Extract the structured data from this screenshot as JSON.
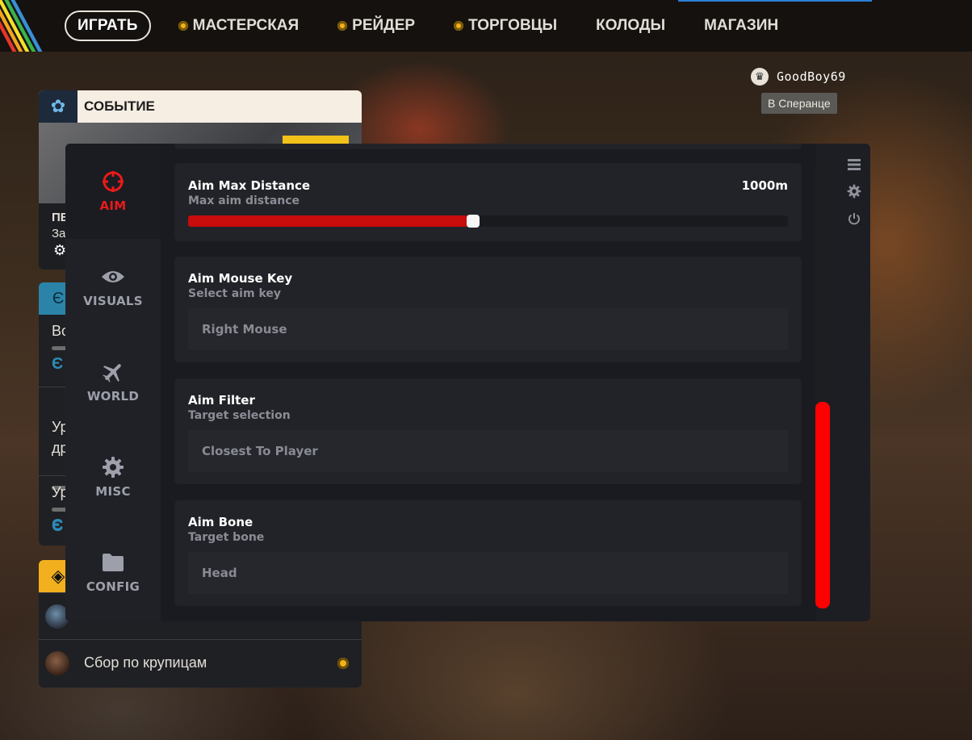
{
  "nav": {
    "play": "ИГРАТЬ",
    "items": [
      {
        "label": "МАСТЕРСКАЯ",
        "coin": true
      },
      {
        "label": "РЕЙДЕР",
        "coin": true
      },
      {
        "label": "ТОРГОВЦЫ",
        "coin": true
      },
      {
        "label": "КОЛОДЫ",
        "coin": false
      },
      {
        "label": "МАГАЗИН",
        "coin": false
      }
    ]
  },
  "player": {
    "name": "GoodBoy69",
    "status": "В Сперанце"
  },
  "event_panel": {
    "title": "СОБЫТИЕ",
    "line1": "ПЕ",
    "line2": "За"
  },
  "tasks_panel": {
    "rows": [
      "Во",
      "Ур\nдр",
      "Ур"
    ],
    "currency_icon": "Є"
  },
  "raid_panel": {
    "rows": [
      {
        "label": ""
      },
      {
        "label": "Сбор по крупицам"
      }
    ]
  },
  "menu": {
    "tabs": [
      {
        "label": "AIM",
        "icon": "crosshair-icon",
        "active": true
      },
      {
        "label": "VISUALS",
        "icon": "eye-icon",
        "active": false
      },
      {
        "label": "WORLD",
        "icon": "plane-icon",
        "active": false
      },
      {
        "label": "MISC",
        "icon": "gear-icon",
        "active": false
      },
      {
        "label": "CONFIG",
        "icon": "folder-icon",
        "active": false
      }
    ],
    "settings": {
      "max_distance": {
        "title": "Aim Max Distance",
        "subtitle": "Max aim distance",
        "value_label": "1000m",
        "fill_fraction": 0.475
      },
      "mouse_key": {
        "title": "Aim Mouse Key",
        "subtitle": "Select aim key",
        "value": "Right Mouse"
      },
      "filter": {
        "title": "Aim Filter",
        "subtitle": "Target selection",
        "value": "Closest To Player"
      },
      "bone": {
        "title": "Aim Bone",
        "subtitle": "Target bone",
        "value": "Head"
      }
    },
    "scrollbar": {
      "thumb_start_fraction": 0.55,
      "thumb_end_fraction": 1.0
    },
    "rail_icons": [
      "list-icon",
      "settings-icon",
      "power-icon"
    ]
  },
  "colors": {
    "accent_red": "#ff0000",
    "slider_fill": "#c80b0b",
    "nav_coin": "#f2b21a"
  }
}
